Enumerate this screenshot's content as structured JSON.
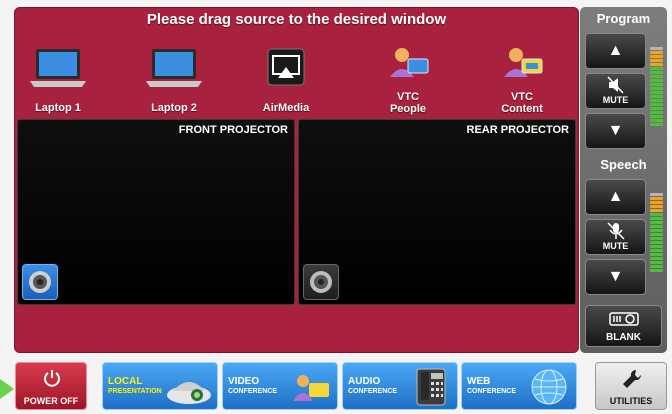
{
  "header": {
    "title": "Please drag source to the desired window"
  },
  "sources": [
    {
      "label": "Laptop 1",
      "icon": "laptop-icon"
    },
    {
      "label": "Laptop 2",
      "icon": "laptop-icon"
    },
    {
      "label": "AirMedia",
      "icon": "airmedia-icon"
    },
    {
      "label": "VTC\nPeople",
      "line1": "VTC",
      "line2": "People",
      "icon": "vtc-people-icon"
    },
    {
      "label": "VTC\nContent",
      "line1": "VTC",
      "line2": "Content",
      "icon": "vtc-content-icon"
    }
  ],
  "windows": {
    "front": {
      "title": "FRONT PROJECTOR",
      "speaker": "active"
    },
    "rear": {
      "title": "REAR PROJECTOR",
      "speaker": "inactive"
    }
  },
  "program": {
    "title": "Program",
    "mute_label": "MUTE"
  },
  "speech": {
    "title": "Speech",
    "mute_label": "MUTE"
  },
  "blank": {
    "label": "BLANK"
  },
  "bottom": {
    "power": {
      "label": "POWER OFF"
    },
    "local": {
      "line1": "LOCAL",
      "line2": "PRESENTATION"
    },
    "video": {
      "line1": "VIDEO",
      "line2": "CONFERENCE"
    },
    "audio": {
      "line1": "AUDIO",
      "line2": "CONFERENCE"
    },
    "web": {
      "line1": "WEB",
      "line2": "CONFERENCE"
    },
    "utilities": {
      "label": "UTILITIES"
    }
  },
  "colors": {
    "panel": "#a8213e",
    "accent_blue": "#2f86de",
    "meter_green": "#4fbf3a",
    "meter_orange": "#f2a31b",
    "indicator_green": "#6ad14a",
    "local_text": "#fff200"
  }
}
